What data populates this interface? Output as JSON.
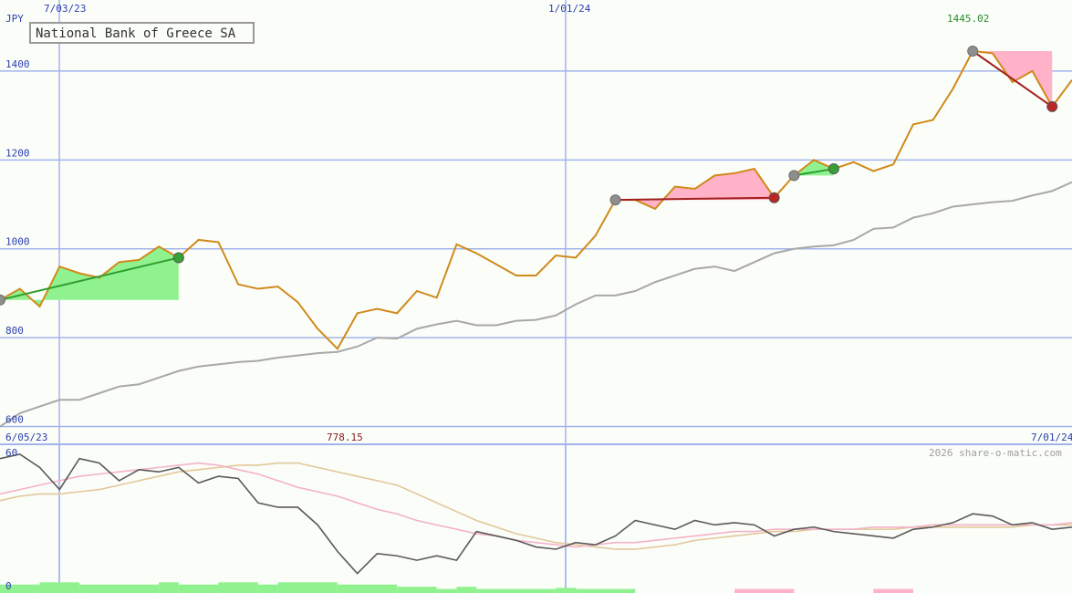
{
  "chart_data": [
    {
      "type": "line",
      "title": "National Bank of Greece SA",
      "currency_label": "JPY",
      "date_labels": [
        "7/03/23",
        "1/01/24"
      ],
      "top_right_value": "1445.02",
      "y_ticks": [
        600,
        800,
        1000,
        1200,
        1400
      ],
      "ylim": [
        560,
        1560
      ],
      "x_range": [
        "6/05/23",
        "7/01/24"
      ],
      "grid": true,
      "series": [
        {
          "values": [
            885,
            910,
            870,
            960,
            945,
            935,
            970,
            975,
            1005,
            980,
            1020,
            1015,
            920,
            910,
            915,
            880,
            820,
            775,
            855,
            865,
            855,
            905,
            890,
            1010,
            990,
            965,
            940,
            940,
            985,
            980,
            1030,
            1110,
            1110,
            1090,
            1140,
            1135,
            1165,
            1170,
            1180,
            1115,
            1165,
            1200,
            1180,
            1195,
            1175,
            1190,
            1280,
            1290,
            1360,
            1445,
            1440,
            1375,
            1400,
            1320,
            1380
          ]
        },
        {
          "values": [
            600,
            630,
            645,
            660,
            660,
            675,
            690,
            695,
            710,
            725,
            735,
            740,
            745,
            748,
            755,
            760,
            765,
            768,
            780,
            800,
            798,
            820,
            830,
            838,
            828,
            828,
            838,
            840,
            850,
            875,
            895,
            895,
            905,
            925,
            940,
            955,
            960,
            950,
            970,
            990,
            1000,
            1005,
            1008,
            1020,
            1045,
            1048,
            1070,
            1080,
            1095,
            1100,
            1105,
            1108,
            1120,
            1130,
            1150
          ]
        }
      ],
      "trades": [
        {
          "entry_index": 0,
          "exit_index": 9,
          "result": "gain"
        },
        {
          "entry_index": 31,
          "exit_index": 39,
          "result": "loss"
        },
        {
          "entry_index": 40,
          "exit_index": 42,
          "result": "gain"
        },
        {
          "entry_index": 49,
          "exit_index": 53,
          "result": "loss"
        }
      ]
    },
    {
      "type": "line",
      "y_ticks": [
        0,
        60
      ],
      "ylim": [
        0,
        64
      ],
      "start_label": "6/05/23",
      "end_label": "7/01/24",
      "marker_value": "778.15",
      "copyright": "2026 share-o-matic.com",
      "series": [
        {
          "values": [
            60,
            62,
            56,
            46,
            60,
            58,
            50,
            55,
            54,
            56,
            49,
            52,
            51,
            40,
            38,
            38,
            30,
            18,
            8,
            17,
            16,
            14,
            16,
            14,
            27,
            25,
            23,
            20,
            19,
            22,
            21,
            25,
            32,
            30,
            28,
            32,
            30,
            31,
            30,
            25,
            28,
            29,
            27,
            26,
            25,
            24,
            28,
            29,
            31,
            35,
            34,
            30,
            31,
            28,
            29
          ]
        },
        {
          "values": [
            44,
            46,
            48,
            50,
            52,
            53,
            54,
            55,
            56,
            57,
            58,
            57,
            55,
            53,
            50,
            47,
            45,
            43,
            40,
            37,
            35,
            32,
            30,
            28,
            26,
            25,
            23,
            22,
            21,
            20,
            21,
            22,
            22,
            23,
            24,
            25,
            26,
            27,
            27,
            28,
            28,
            28,
            28,
            28,
            29,
            29,
            29,
            30,
            30,
            30,
            30,
            30,
            30,
            30,
            31
          ]
        },
        {
          "values": [
            41,
            43,
            44,
            44,
            45,
            46,
            48,
            50,
            52,
            54,
            55,
            56,
            57,
            57,
            58,
            58,
            56,
            54,
            52,
            50,
            48,
            44,
            40,
            36,
            32,
            29,
            26,
            24,
            22,
            21,
            20,
            19,
            19,
            20,
            21,
            23,
            24,
            25,
            26,
            27,
            27,
            28,
            28,
            28,
            28,
            28,
            29,
            29,
            29,
            29,
            29,
            29,
            30,
            30,
            30
          ]
        }
      ],
      "bars": [
        {
          "from_index": 0,
          "to_index": 2,
          "value": 3,
          "state": "gain"
        },
        {
          "from_index": 2,
          "to_index": 4,
          "value": 4,
          "state": "gain"
        },
        {
          "from_index": 4,
          "to_index": 8,
          "value": 3,
          "state": "gain"
        },
        {
          "from_index": 8,
          "to_index": 9,
          "value": 4,
          "state": "gain"
        },
        {
          "from_index": 9,
          "to_index": 11,
          "value": 3,
          "state": "gain"
        },
        {
          "from_index": 11,
          "to_index": 13,
          "value": 4,
          "state": "gain"
        },
        {
          "from_index": 13,
          "to_index": 14,
          "value": 3,
          "state": "gain"
        },
        {
          "from_index": 14,
          "to_index": 17,
          "value": 4,
          "state": "gain"
        },
        {
          "from_index": 17,
          "to_index": 20,
          "value": 3,
          "state": "gain"
        },
        {
          "from_index": 20,
          "to_index": 22,
          "value": 2,
          "state": "gain"
        },
        {
          "from_index": 22,
          "to_index": 23,
          "value": 1,
          "state": "gain"
        },
        {
          "from_index": 23,
          "to_index": 24,
          "value": 2,
          "state": "gain"
        },
        {
          "from_index": 24,
          "to_index": 28,
          "value": 1,
          "state": "gain"
        },
        {
          "from_index": 28,
          "to_index": 29,
          "value": 1.5,
          "state": "gain"
        },
        {
          "from_index": 29,
          "to_index": 32,
          "value": 1,
          "state": "gain"
        },
        {
          "from_index": 37,
          "to_index": 40,
          "value": 1,
          "state": "loss"
        },
        {
          "from_index": 44,
          "to_index": 46,
          "value": 1,
          "state": "loss"
        },
        {
          "from_index": 54,
          "to_index": 55,
          "value": 1,
          "state": "loss"
        }
      ]
    }
  ],
  "colors": {
    "background": "#fbfdf9",
    "grid": "#a3b4ec",
    "axis_label": "#2b3fae",
    "price": "#d08a1a",
    "reference": "#a8a8a8",
    "gain_fill": "#8ff28f",
    "loss_fill": "#ffb2c8",
    "gain_line": "#2e9e2e",
    "loss_line": "#a41f1f",
    "entry_marker": "#8e8e8e",
    "gain_marker": "#36a236",
    "loss_marker": "#bd2525",
    "osc_dark": "#5a5a5a",
    "osc_tan": "#e2c899",
    "osc_pink": "#f4b2c6",
    "peak_label": "#2a8a2a",
    "marker_label": "#8a1a1a",
    "copyright": "#a0a0a0",
    "title": "#333333"
  }
}
